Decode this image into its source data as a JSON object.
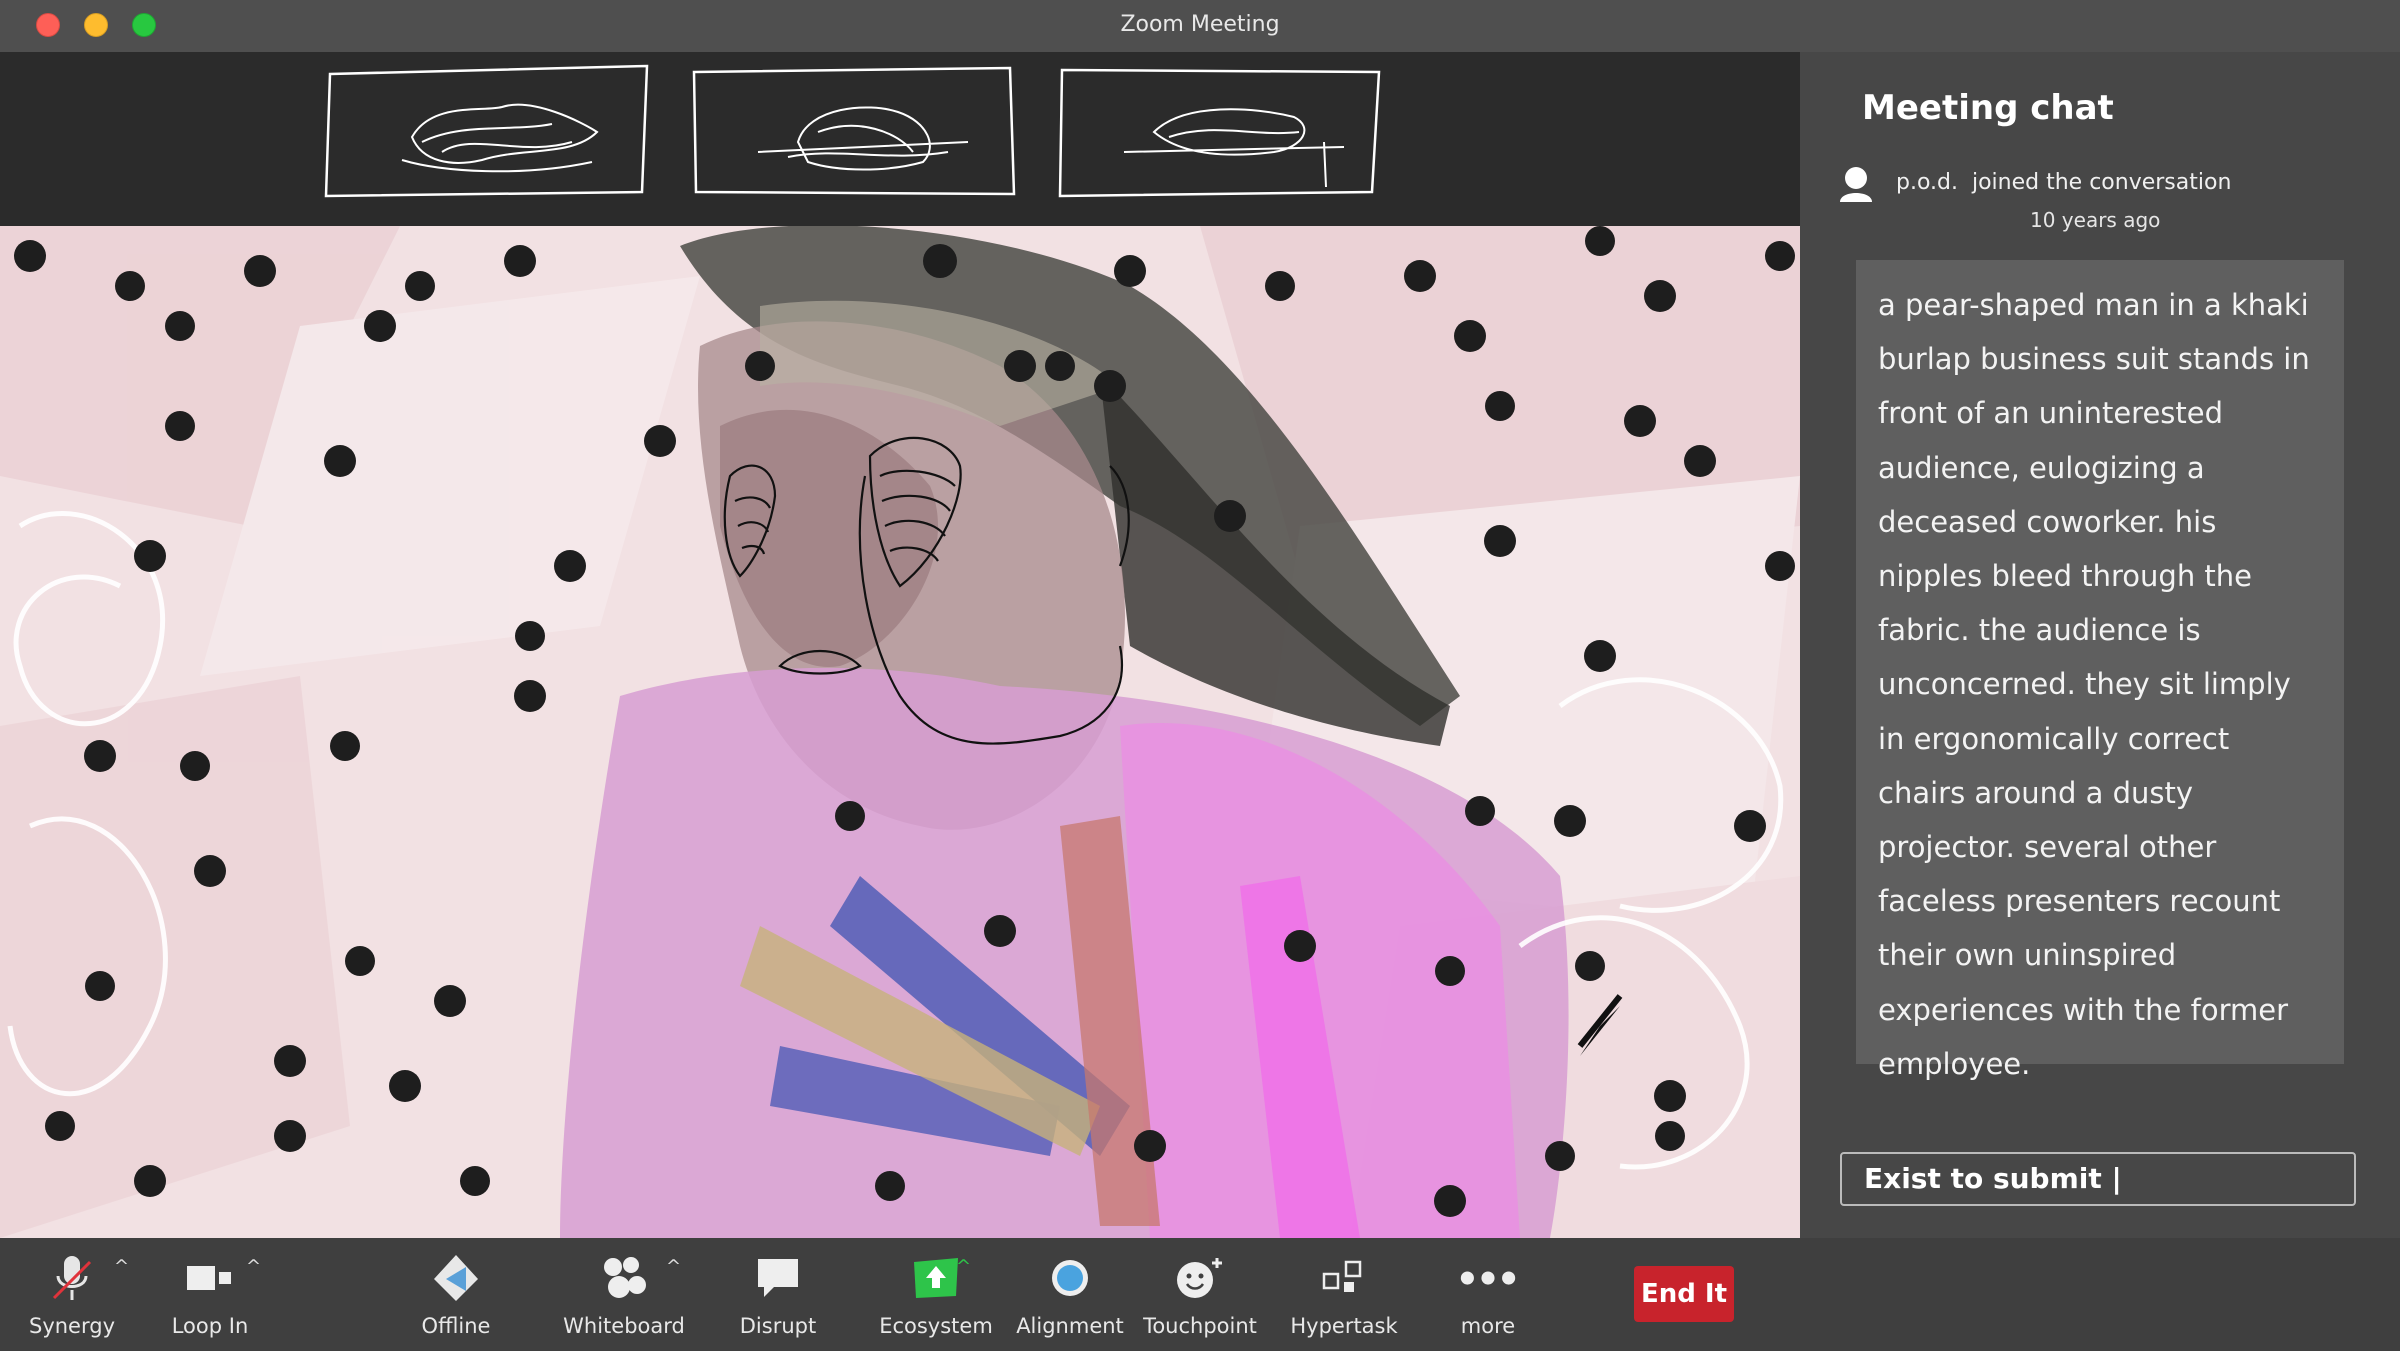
{
  "window": {
    "title": "Zoom Meeting"
  },
  "chat": {
    "title": "Meeting chat",
    "joined_user": "p.o.d.",
    "joined_text": "joined the conversation",
    "joined_time": "10 years ago",
    "message": "a pear-shaped man in a khaki burlap business suit stands in front of an uninterested audience, eulogizing a deceased coworker. his nipples bleed through the fabric. the audience is unconcerned. they sit limply in ergonomically correct chairs around a dusty projector. several other faceless presenters recount their own uninspired experiences with the former employee.",
    "input_value": "Exist to submit |"
  },
  "toolbar": {
    "synergy": "Synergy",
    "loop_in": "Loop In",
    "offline": "Offline",
    "whiteboard": "Whiteboard",
    "disrupt": "Disrupt",
    "ecosystem": "Ecosystem",
    "alignment": "Alignment",
    "touchpoint": "Touchpoint",
    "hypertask": "Hypertask",
    "more": "more",
    "end": "End It"
  },
  "colors": {
    "end_button": "#c8232c",
    "ecosystem_icon": "#2ec44a",
    "alignment_icon": "#4aa3df"
  },
  "icons": {
    "synergy": "muted-microphone-icon",
    "loop_in": "video-camera-icon",
    "offline": "share-arrows-icon",
    "whiteboard": "participants-icon",
    "disrupt": "chat-bubble-icon",
    "ecosystem": "share-screen-icon",
    "alignment": "record-icon",
    "touchpoint": "reactions-icon",
    "hypertask": "apps-icon",
    "more": "more-dots-icon"
  }
}
